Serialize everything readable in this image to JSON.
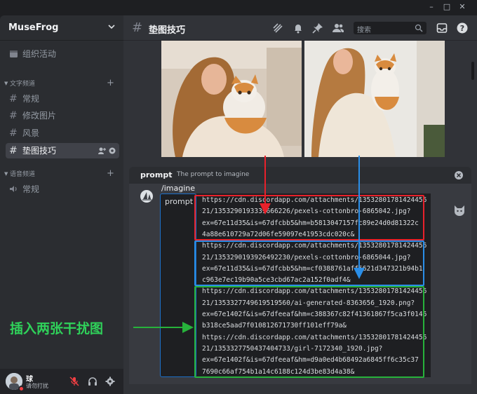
{
  "window": {
    "minimize": "–",
    "maximize": "□",
    "close": "✕"
  },
  "server": {
    "name": "MuseFrog"
  },
  "sidebar": {
    "event_item": {
      "label": "组织活动"
    },
    "text_category": "文字频道",
    "text_channels": [
      {
        "label": "常规"
      },
      {
        "label": "修改图片"
      },
      {
        "label": "风景"
      },
      {
        "label": "垫图技巧",
        "active": true
      }
    ],
    "voice_category": "语音频道",
    "voice_channels": [
      {
        "label": "常规"
      }
    ]
  },
  "user": {
    "name": "球",
    "status": "请勿打扰"
  },
  "header": {
    "channel": "垫图技巧",
    "search_placeholder": "搜索"
  },
  "prompt_bar": {
    "name": "prompt",
    "description": "The prompt to imagine"
  },
  "composer": {
    "command": "/imagine",
    "param_label": "prompt",
    "lines": [
      "https://cdn.discordapp.com/attachments/13532801781424456",
      "21/1353290193339666226/pexels-cottonbro-6865042.jpg?",
      "ex=67e11d35&is=67dfcbb5&hm=b5813047157fc89e24d0d81322c",
      "4a88e610729a72d06fe59097e41953cdc020c&",
      "https://cdn.discordapp.com/attachments/13532801781424456",
      "21/1353290193926492230/pexels-cottonbro-6865044.jpg?",
      "ex=67e11d35&is=67dfcbb5&hm=cf0388761aff5621d347321b94b1",
      "c963e7ec19b90a5ce3cbd67ac2a152f0adf4&",
      "https://cdn.discordapp.com/attachments/13532801781424456",
      "21/1353327749619519560/ai-generated-8363656_1920.png?",
      "ex=67e1402f&is=67dfeeaf&hm=c388367c82f41361867f5ca3f0146",
      "b318ce5aad7f010812671730ff101eff79a&",
      "https://cdn.discordapp.com/attachments/13532801781424456",
      "21/1353327750437404733/girl-7172340_1920.jpg?",
      "ex=67e1402f&is=67dfeeaf&hm=d9a0ed4b68492a6845ff6c35c37",
      "7690c66af754b1a14c6188c124d3be83d4a38&"
    ]
  },
  "annotation": {
    "label": "插入两张干扰图"
  },
  "colors": {
    "red": "#e8212b",
    "blue": "#2a8ee8",
    "green": "#27b23b",
    "annot_text": "#2fd15a"
  }
}
